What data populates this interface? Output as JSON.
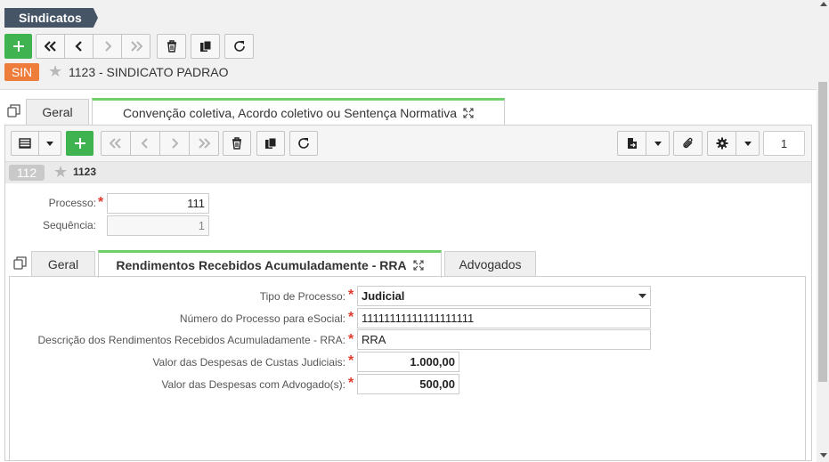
{
  "breadcrumb": "Sindicatos",
  "record": {
    "badge": "SIN",
    "title": "1123 - SINDICATO PADRAO"
  },
  "outer_tabs": [
    {
      "label": "Geral"
    },
    {
      "label": "Convenção coletiva, Acordo coletivo ou Sentença Normativa"
    }
  ],
  "inner_record": {
    "badge": "112",
    "id": "1123"
  },
  "page_number": "1",
  "form": {
    "processo_label": "Processo:",
    "processo_value": "111",
    "sequencia_label": "Sequência:",
    "sequencia_value": "1"
  },
  "inner_tabs": [
    {
      "label": "Geral"
    },
    {
      "label": "Rendimentos Recebidos Acumuladamente - RRA"
    },
    {
      "label": "Advogados"
    }
  ],
  "rra": {
    "tipo_label": "Tipo de Processo:",
    "tipo_value": "Judicial",
    "numero_label": "Número do Processo para eSocial:",
    "numero_value": "11111111111111111111",
    "descricao_label": "Descrição dos Rendimentos Recebidos Acumuladamente - RRA:",
    "descricao_value": "RRA",
    "custas_label": "Valor das Despesas de Custas Judiciais:",
    "custas_value": "1.000,00",
    "advogado_label": "Valor das Despesas com Advogado(s):",
    "advogado_value": "500,00"
  },
  "colors": {
    "accent_green": "#3fb34f",
    "badge_orange": "#ee7c3b",
    "crumb": "#455566",
    "required": "#e03b2e"
  }
}
